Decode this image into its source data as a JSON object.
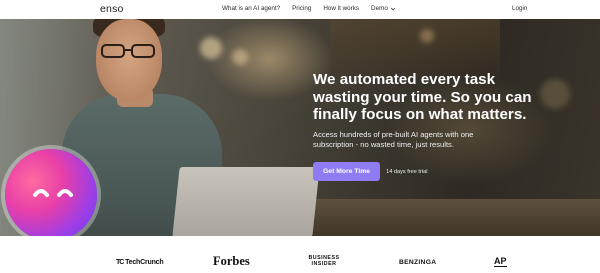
{
  "navbar": {
    "logo": "enso",
    "links": [
      "What is an AI agent?",
      "Pricing",
      "How it works",
      "Demo"
    ],
    "login": "Login"
  },
  "hero": {
    "headline": "We automated every task wasting your time. So you can finally focus on what matters.",
    "subtext": "Access hundreds of pre-built AI agents with one subscription - no wasted time, just results.",
    "cta_label": "Get More Time",
    "trial_note": "14 days free trial"
  },
  "press": {
    "logos": [
      "TechCrunch",
      "Forbes",
      "BUSINESS INSIDER",
      "BENZINGA",
      "AP"
    ]
  },
  "colors": {
    "accent": "#8f7cf2",
    "text_dark": "#1a1a1a",
    "hero_text": "#ffffff"
  },
  "icons": [
    "chevron-down-icon",
    "emoji-face-icon"
  ]
}
